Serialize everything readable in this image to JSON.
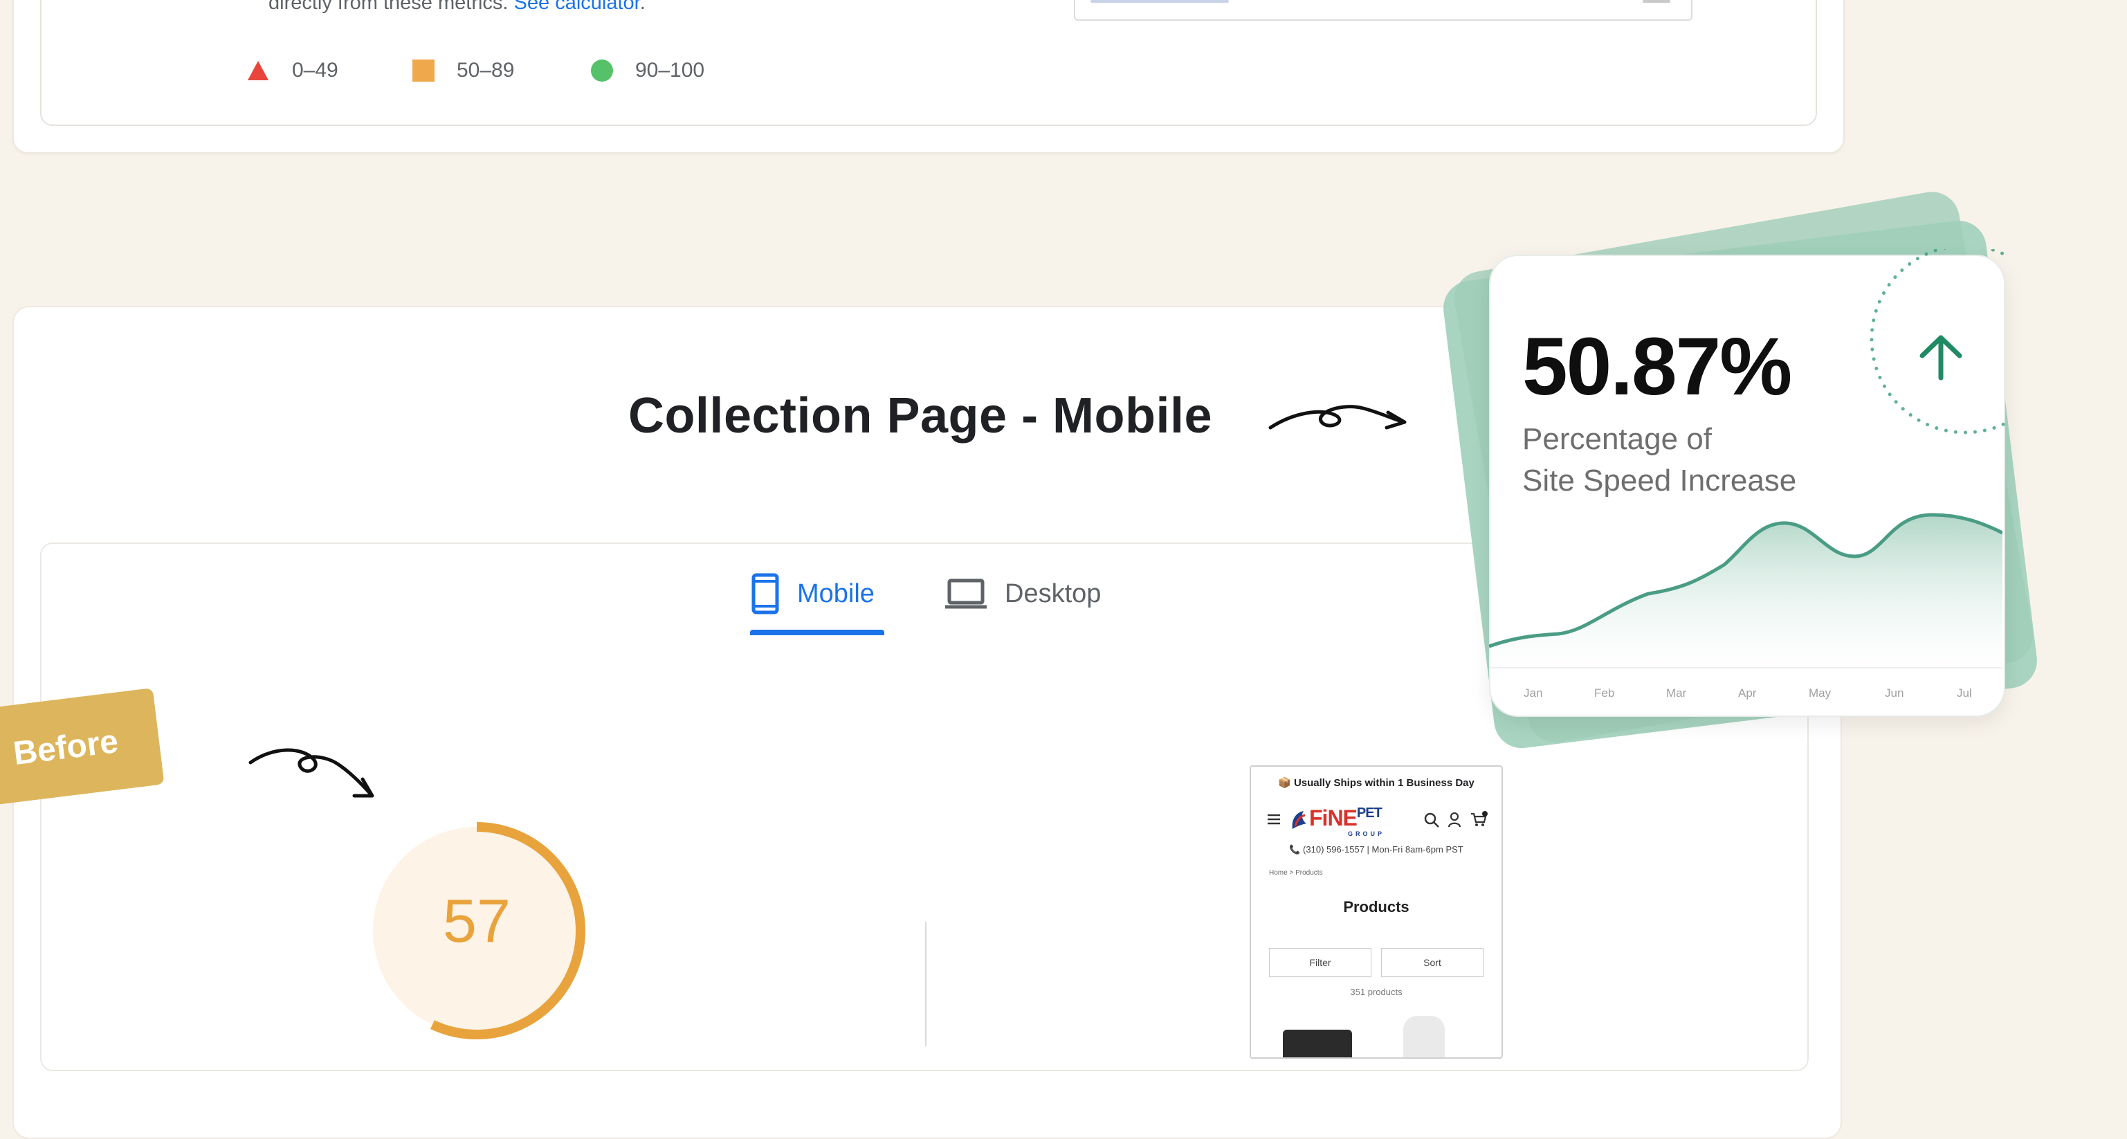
{
  "top_report": {
    "description_prefix": "directly from these metrics.",
    "calculator_link": "See calculator",
    "description_suffix": ".",
    "legend": [
      {
        "shape": "triangle",
        "color": "#e8453c",
        "label": "0–49"
      },
      {
        "shape": "square",
        "color": "#f0a84d",
        "label": "50–89"
      },
      {
        "shape": "circle",
        "color": "#55c26a",
        "label": "90–100"
      }
    ]
  },
  "collection": {
    "title": "Collection Page - Mobile",
    "tabs": [
      {
        "label": "Mobile",
        "icon": "smartphone-icon",
        "active": true
      },
      {
        "label": "Desktop",
        "icon": "laptop-icon",
        "active": false
      }
    ],
    "before_tag": "Before",
    "performance_score": "57",
    "score_fraction": 0.57,
    "score_color": "#e8a33d"
  },
  "phone_preview": {
    "shipping_banner": "📦 Usually Ships within 1 Business Day",
    "logo_main": "FiNE",
    "logo_sup": "PET",
    "logo_sub": "GROUP",
    "contact": "📞 (310) 596-1557 | Mon-Fri 8am-6pm PST",
    "breadcrumb": "Home  >  Products",
    "page_title": "Products",
    "filter_label": "Filter",
    "sort_label": "Sort",
    "product_count": "351 products"
  },
  "stat_card": {
    "value": "50.87%",
    "label_line1": "Percentage of",
    "label_line2": "Site Speed Increase",
    "accent": "#1f8a63",
    "months": [
      "Jan",
      "Feb",
      "Mar",
      "Apr",
      "May",
      "Jun",
      "Jul"
    ]
  }
}
